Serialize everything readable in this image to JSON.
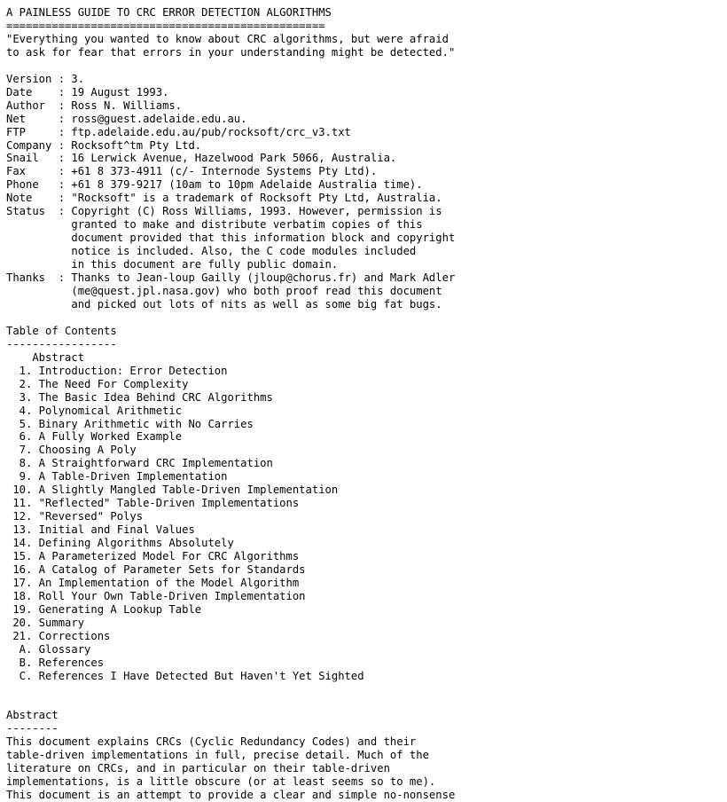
{
  "document": {
    "title": "A PAINLESS GUIDE TO CRC ERROR DETECTION ALGORITHMS",
    "title_rule": "=================================================",
    "epigraph": "\"Everything you wanted to know about CRC algorithms, but were afraid\nto ask for fear that errors in your understanding might be detected.\"",
    "info_block": "Version : 3.\nDate    : 19 August 1993.\nAuthor  : Ross N. Williams.\nNet     : ross@guest.adelaide.edu.au.\nFTP     : ftp.adelaide.edu.au/pub/rocksoft/crc_v3.txt\nCompany : Rocksoft^tm Pty Ltd.\nSnail   : 16 Lerwick Avenue, Hazelwood Park 5066, Australia.\nFax     : +61 8 373-4911 (c/- Internode Systems Pty Ltd).\nPhone   : +61 8 379-9217 (10am to 10pm Adelaide Australia time).\nNote    : \"Rocksoft\" is a trademark of Rocksoft Pty Ltd, Australia.\nStatus  : Copyright (C) Ross Williams, 1993. However, permission is\n          granted to make and distribute verbatim copies of this\n          document provided that this information block and copyright\n          notice is included. Also, the C code modules included\n          in this document are fully public domain.\nThanks  : Thanks to Jean-loup Gailly (jloup@chorus.fr) and Mark Adler\n          (me@quest.jpl.nasa.gov) who both proof read this document\n          and picked out lots of nits as well as some big fat bugs.",
    "toc_heading": "Table of Contents",
    "toc_rule": "-----------------",
    "toc": "    Abstract\n  1. Introduction: Error Detection\n  2. The Need For Complexity\n  3. The Basic Idea Behind CRC Algorithms\n  4. Polynomical Arithmetic\n  5. Binary Arithmetic with No Carries\n  6. A Fully Worked Example\n  7. Choosing A Poly\n  8. A Straightforward CRC Implementation\n  9. A Table-Driven Implementation\n 10. A Slightly Mangled Table-Driven Implementation\n 11. \"Reflected\" Table-Driven Implementations\n 12. \"Reversed\" Polys\n 13. Initial and Final Values\n 14. Defining Algorithms Absolutely\n 15. A Parameterized Model For CRC Algorithms\n 16. A Catalog of Parameter Sets for Standards\n 17. An Implementation of the Model Algorithm\n 18. Roll Your Own Table-Driven Implementation\n 19. Generating A Lookup Table\n 20. Summary\n 21. Corrections\n  A. Glossary\n  B. References\n  C. References I Have Detected But Haven't Yet Sighted",
    "abstract_heading": "Abstract",
    "abstract_rule": "--------",
    "abstract_body": "This document explains CRCs (Cyclic Redundancy Codes) and their\ntable-driven implementations in full, precise detail. Much of the\nliterature on CRCs, and in particular on their table-driven\nimplementations, is a little obscure (or at least seems so to me).",
    "abstract_clipped_line": "This document is an attempt to provide a clear and simple no-nonsense"
  },
  "toc_entries": [
    {
      "number": "",
      "label": "Abstract"
    },
    {
      "number": "1.",
      "label": "Introduction: Error Detection"
    },
    {
      "number": "2.",
      "label": "The Need For Complexity"
    },
    {
      "number": "3.",
      "label": "The Basic Idea Behind CRC Algorithms"
    },
    {
      "number": "4.",
      "label": "Polynomical Arithmetic"
    },
    {
      "number": "5.",
      "label": "Binary Arithmetic with No Carries"
    },
    {
      "number": "6.",
      "label": "A Fully Worked Example"
    },
    {
      "number": "7.",
      "label": "Choosing A Poly"
    },
    {
      "number": "8.",
      "label": "A Straightforward CRC Implementation"
    },
    {
      "number": "9.",
      "label": "A Table-Driven Implementation"
    },
    {
      "number": "10.",
      "label": "A Slightly Mangled Table-Driven Implementation"
    },
    {
      "number": "11.",
      "label": "\"Reflected\" Table-Driven Implementations"
    },
    {
      "number": "12.",
      "label": "\"Reversed\" Polys"
    },
    {
      "number": "13.",
      "label": "Initial and Final Values"
    },
    {
      "number": "14.",
      "label": "Defining Algorithms Absolutely"
    },
    {
      "number": "15.",
      "label": "A Parameterized Model For CRC Algorithms"
    },
    {
      "number": "16.",
      "label": "A Catalog of Parameter Sets for Standards"
    },
    {
      "number": "17.",
      "label": "An Implementation of the Model Algorithm"
    },
    {
      "number": "18.",
      "label": "Roll Your Own Table-Driven Implementation"
    },
    {
      "number": "19.",
      "label": "Generating A Lookup Table"
    },
    {
      "number": "20.",
      "label": "Summary"
    },
    {
      "number": "21.",
      "label": "Corrections"
    },
    {
      "number": "A.",
      "label": "Glossary"
    },
    {
      "number": "B.",
      "label": "References"
    },
    {
      "number": "C.",
      "label": "References I Have Detected But Haven't Yet Sighted"
    }
  ],
  "info_fields": [
    {
      "label": "Version",
      "value": "3."
    },
    {
      "label": "Date",
      "value": "19 August 1993."
    },
    {
      "label": "Author",
      "value": "Ross N. Williams."
    },
    {
      "label": "Net",
      "value": "ross@guest.adelaide.edu.au."
    },
    {
      "label": "FTP",
      "value": "ftp.adelaide.edu.au/pub/rocksoft/crc_v3.txt"
    },
    {
      "label": "Company",
      "value": "Rocksoft^tm Pty Ltd."
    },
    {
      "label": "Snail",
      "value": "16 Lerwick Avenue, Hazelwood Park 5066, Australia."
    },
    {
      "label": "Fax",
      "value": "+61 8 373-4911 (c/- Internode Systems Pty Ltd)."
    },
    {
      "label": "Phone",
      "value": "+61 8 379-9217 (10am to 10pm Adelaide Australia time)."
    },
    {
      "label": "Note",
      "value": "\"Rocksoft\" is a trademark of Rocksoft Pty Ltd, Australia."
    },
    {
      "label": "Status",
      "value": "Copyright (C) Ross Williams, 1993. However, permission is granted to make and distribute verbatim copies of this document provided that this information block and copyright notice is included. Also, the C code modules included in this document are fully public domain."
    },
    {
      "label": "Thanks",
      "value": "Thanks to Jean-loup Gailly (jloup@chorus.fr) and Mark Adler (me@quest.jpl.nasa.gov) who both proof read this document and picked out lots of nits as well as some big fat bugs."
    }
  ],
  "colors": {
    "background": "#ffffff",
    "text": "#000000"
  }
}
